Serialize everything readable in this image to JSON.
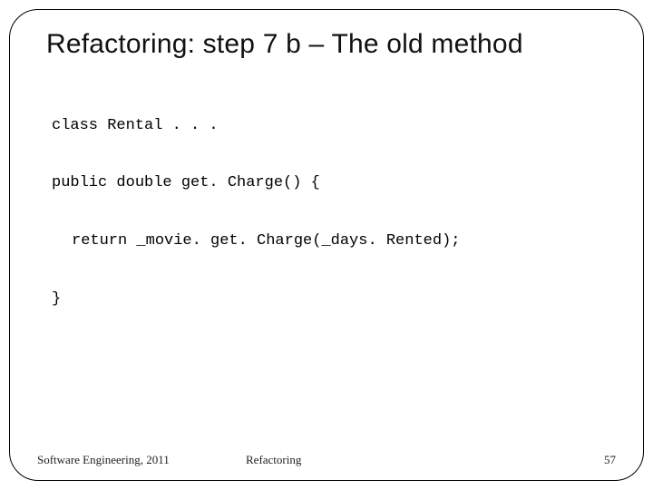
{
  "title": "Refactoring: step 7 b – The old method",
  "code": {
    "line1": "class Rental . . .",
    "line2": "public double get. Charge() {",
    "line3": "return _movie. get. Charge(_days. Rented);",
    "line4": "}"
  },
  "footer": {
    "left": "Software Engineering, 2011",
    "center": "Refactoring",
    "pageNumber": "57"
  }
}
